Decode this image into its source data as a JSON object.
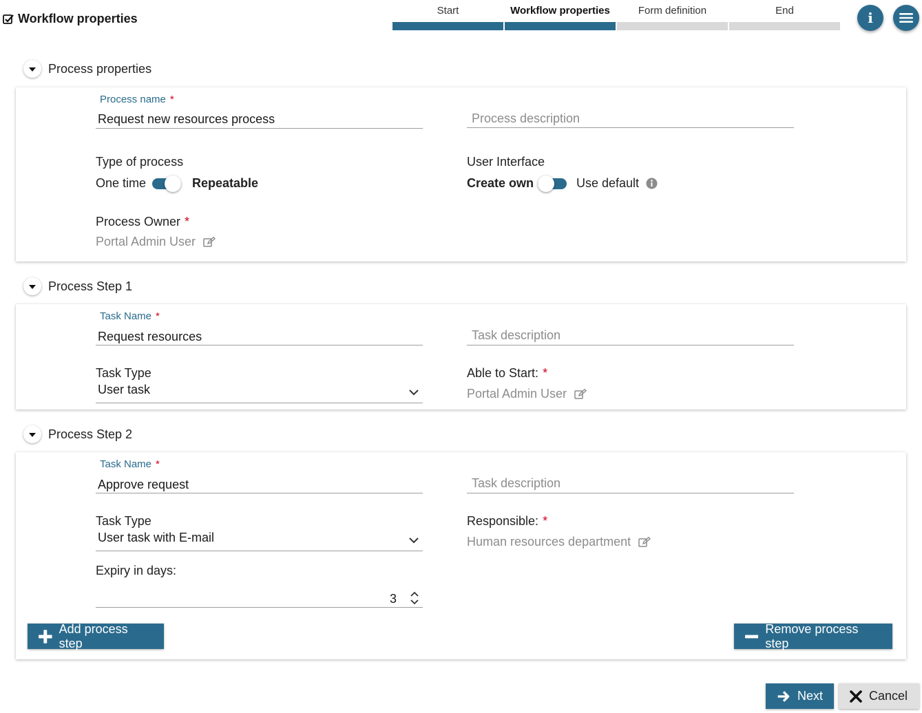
{
  "header": {
    "title": "Workflow properties",
    "steps": [
      {
        "label": "Start"
      },
      {
        "label": "Workflow properties"
      },
      {
        "label": "Form definition"
      },
      {
        "label": "End"
      }
    ],
    "info_label": "i"
  },
  "process_properties": {
    "section_title": "Process properties",
    "process_name_label": "Process name",
    "process_name_value": "Request new resources process",
    "process_description_placeholder": "Process description",
    "type_label": "Type of process",
    "type_option_left": "One time",
    "type_option_right": "Repeatable",
    "ui_label": "User Interface",
    "ui_option_left": "Create own",
    "ui_option_right": "Use default",
    "owner_label": "Process Owner",
    "owner_value": "Portal Admin User"
  },
  "step1": {
    "section_title": "Process Step 1",
    "task_name_label": "Task Name",
    "task_name_value": "Request resources",
    "task_description_placeholder": "Task description",
    "task_type_label": "Task Type",
    "task_type_value": "User task",
    "assignee_label": "Able to Start:",
    "assignee_value": "Portal Admin User"
  },
  "step2": {
    "section_title": "Process Step 2",
    "task_name_label": "Task Name",
    "task_name_value": "Approve request",
    "task_description_placeholder": "Task description",
    "task_type_label": "Task Type",
    "task_type_value": "User task with E-mail",
    "assignee_label": "Responsible:",
    "assignee_value": "Human resources department",
    "expiry_label": "Expiry in days:",
    "expiry_value": "3"
  },
  "actions": {
    "add_step": "Add process step",
    "remove_step": "Remove process step",
    "next": "Next",
    "cancel": "Cancel"
  },
  "colors": {
    "accent": "#2a6b8d",
    "required": "#d0021b",
    "inactive_step": "#d9d9d9"
  }
}
